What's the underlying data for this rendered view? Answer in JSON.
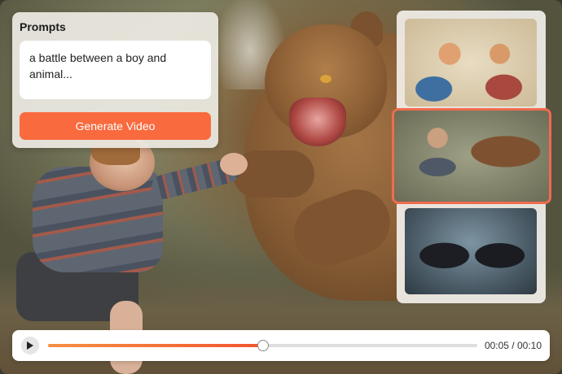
{
  "prompt_panel": {
    "title": "Prompts",
    "prompt_text": "a battle between a boy and animal...",
    "generate_button_label": "Generate Video"
  },
  "thumbnails": [
    {
      "label": "anime boy and girl fist bump",
      "selected": false
    },
    {
      "label": "boy versus bear",
      "selected": true
    },
    {
      "label": "dark monsters battle",
      "selected": false
    }
  ],
  "player": {
    "current_time": "00:05",
    "total_time": "00:10",
    "time_display": "00:05 / 00:10",
    "progress": 0.5,
    "play_icon": "play-icon",
    "accent_color": "#f2552e"
  },
  "colors": {
    "accent": "#f96a3e",
    "selected_border": "#f06b4e"
  }
}
